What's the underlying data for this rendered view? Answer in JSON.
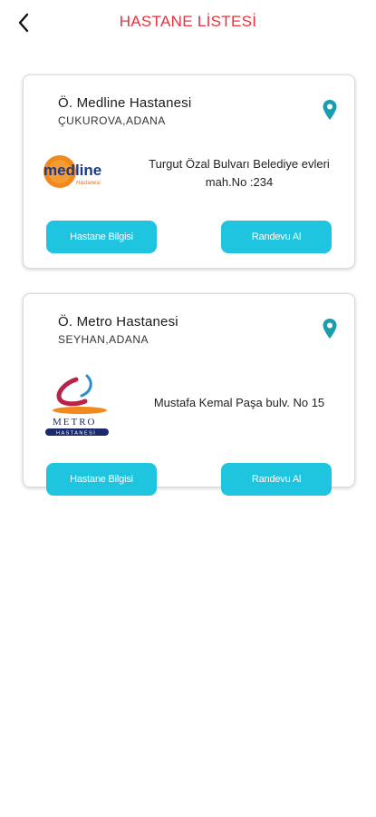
{
  "header": {
    "title": "HASTANE LİSTESİ"
  },
  "hospitals": [
    {
      "name": "Ö. Medline Hastanesi",
      "city": "ÇUKUROVA,ADANA",
      "address": "Turgut Özal Bulvarı Belediye evleri mah.No :234",
      "logo_text": "medline",
      "logo_subtext": "Hastanesi",
      "info_button": "Hastane Bilgisi",
      "appointment_button": "Randevu Al"
    },
    {
      "name": "Ö. Metro Hastanesi",
      "city": "SEYHAN,ADANA",
      "address": "Mustafa Kemal Paşa bulv. No 15",
      "logo_text": "METRO",
      "logo_subtext": "HASTANESİ",
      "info_button": "Hastane Bilgisi",
      "appointment_button": "Randevu Al"
    }
  ],
  "colors": {
    "title": "#e8323c",
    "button": "#1fc4df",
    "pin": "#1a9db0"
  },
  "icons": {
    "back": "chevron-left-icon",
    "location": "map-pin-icon"
  }
}
